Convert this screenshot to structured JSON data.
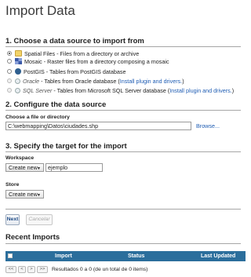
{
  "page": {
    "title": "Import Data"
  },
  "section1": {
    "title": "1. Choose a data source to import from",
    "sources": [
      {
        "name": "Spatial Files",
        "desc": " - Files from a directory or archive",
        "icon": "folder-icon",
        "checked": true,
        "disabled": false,
        "link": ""
      },
      {
        "name": "Mosaic",
        "desc": " - Raster files from a directory composing a mosaic",
        "icon": "mosaic-icon",
        "checked": false,
        "disabled": false,
        "link": ""
      },
      {
        "name": "PostGIS",
        "desc": " - Tables from PostGIS database",
        "icon": "postgis-icon",
        "checked": false,
        "disabled": false,
        "link": ""
      },
      {
        "name": "Oracle",
        "desc": " - Tables from Oracle database (",
        "icon": "database-icon",
        "checked": false,
        "disabled": true,
        "link": "Install plugin and drivers."
      },
      {
        "name": "SQL Server",
        "desc": " - Tables from Microsoft SQL Server database (",
        "icon": "database-icon",
        "checked": false,
        "disabled": true,
        "link": "Install plugin and drivers."
      }
    ],
    "closing_paren": ")"
  },
  "section2": {
    "title": "2. Configure the data source",
    "file_label": "Choose a file or directory",
    "file_value": "C:\\webmapping\\Datos\\ciudades.shp",
    "browse_label": "Browse..."
  },
  "section3": {
    "title": "3. Specify the target for the import",
    "workspace_label": "Workspace",
    "workspace_select": "Create new",
    "workspace_name": "ejemplo",
    "store_label": "Store",
    "store_select": "Create new"
  },
  "buttons": {
    "next": "Next",
    "cancel": "Cancelar"
  },
  "recent": {
    "title": "Recent Imports",
    "columns": [
      "Import",
      "Status",
      "Last Updated"
    ],
    "pager": {
      "first": "<<",
      "prev": "<",
      "next": ">",
      "last": ">>"
    },
    "pager_text": "Resultados 0 a 0 (de un total de 0 items)"
  },
  "colors": {
    "table_header": "#2b6e9c",
    "link": "#1e5cb3"
  }
}
